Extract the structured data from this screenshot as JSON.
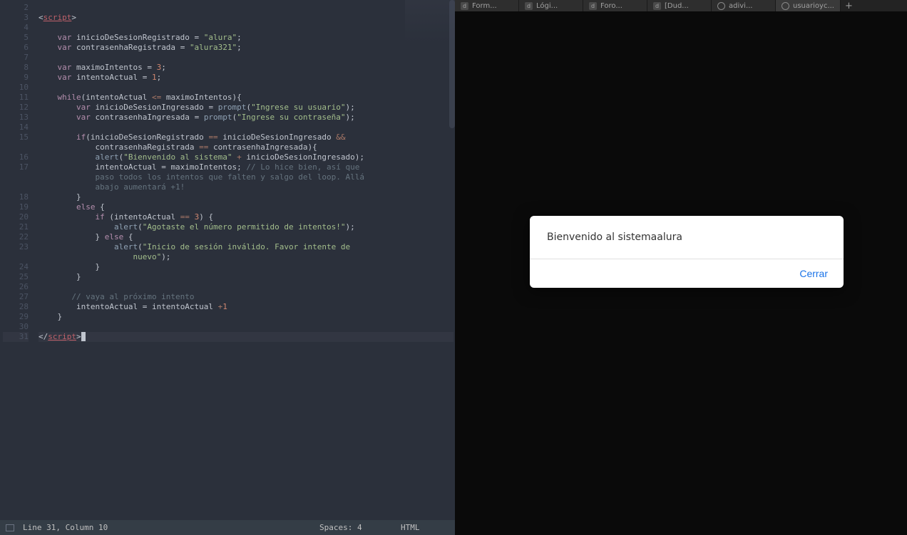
{
  "status_bar": {
    "position": "Line 31, Column 10",
    "spaces": "Spaces: 4",
    "language": "HTML"
  },
  "line_numbers": [
    "2",
    "3",
    "4",
    "5",
    "6",
    "7",
    "8",
    "9",
    "10",
    "11",
    "12",
    "13",
    "14",
    "15",
    "",
    "16",
    "17",
    "",
    "",
    "18",
    "19",
    "20",
    "21",
    "22",
    "23",
    "",
    "24",
    "25",
    "26",
    "27",
    "28",
    "29",
    "30",
    "31"
  ],
  "code_tokens": [
    [],
    [
      [
        "punct",
        "<"
      ],
      [
        "tag",
        "script"
      ],
      [
        "punct",
        ">"
      ]
    ],
    [],
    [
      [
        "kw",
        "    var"
      ],
      [
        "var",
        " inicioDeSesionRegistrado "
      ],
      [
        "op",
        "= "
      ],
      [
        "str",
        "\"alura\""
      ],
      [
        "punct",
        ";"
      ]
    ],
    [
      [
        "kw",
        "    var"
      ],
      [
        "var",
        " contrasenhaRegistrada "
      ],
      [
        "op",
        "= "
      ],
      [
        "str",
        "\"alura321\""
      ],
      [
        "punct",
        ";"
      ]
    ],
    [],
    [
      [
        "kw",
        "    var"
      ],
      [
        "var",
        " maximoIntentos "
      ],
      [
        "op",
        "= "
      ],
      [
        "num",
        "3"
      ],
      [
        "punct",
        ";"
      ]
    ],
    [
      [
        "kw",
        "    var"
      ],
      [
        "var",
        " intentoActual "
      ],
      [
        "op",
        "= "
      ],
      [
        "num",
        "1"
      ],
      [
        "punct",
        ";"
      ]
    ],
    [],
    [
      [
        "kw",
        "    while"
      ],
      [
        "punct",
        "("
      ],
      [
        "var",
        "intentoActual "
      ],
      [
        "op2",
        "<="
      ],
      [
        "var",
        " maximoIntentos"
      ],
      [
        "punct",
        "){"
      ]
    ],
    [
      [
        "kw",
        "        var"
      ],
      [
        "var",
        " inicioDeSesionIngresado "
      ],
      [
        "op",
        "= "
      ],
      [
        "fn",
        "prompt"
      ],
      [
        "punct",
        "("
      ],
      [
        "str",
        "\"Ingrese su usuario\""
      ],
      [
        "punct",
        ");"
      ]
    ],
    [
      [
        "kw",
        "        var"
      ],
      [
        "var",
        " contrasenhaIngresada "
      ],
      [
        "op",
        "= "
      ],
      [
        "fn",
        "prompt"
      ],
      [
        "punct",
        "("
      ],
      [
        "str",
        "\"Ingrese su contraseña\""
      ],
      [
        "punct",
        ");"
      ]
    ],
    [],
    [
      [
        "kw",
        "        if"
      ],
      [
        "punct",
        "("
      ],
      [
        "var",
        "inicioDeSesionRegistrado "
      ],
      [
        "op2",
        "=="
      ],
      [
        "var",
        " inicioDeSesionIngresado "
      ],
      [
        "op2",
        "&&"
      ]
    ],
    [
      [
        "var",
        "            contrasenhaRegistrada "
      ],
      [
        "op2",
        "=="
      ],
      [
        "var",
        " contrasenhaIngresada"
      ],
      [
        "punct",
        "){"
      ]
    ],
    [
      [
        "fn",
        "            alert"
      ],
      [
        "punct",
        "("
      ],
      [
        "str",
        "\"Bienvenido al sistema\""
      ],
      [
        "op2",
        " + "
      ],
      [
        "var",
        "inicioDeSesionIngresado"
      ],
      [
        "punct",
        ");"
      ]
    ],
    [
      [
        "var",
        "            intentoActual "
      ],
      [
        "op",
        "= "
      ],
      [
        "var",
        "maximoIntentos"
      ],
      [
        "punct",
        "; "
      ],
      [
        "cmt",
        "// Lo hice bien, así que"
      ]
    ],
    [
      [
        "cmt",
        "            paso todos los intentos que falten y salgo del loop. Allá"
      ]
    ],
    [
      [
        "cmt",
        "            abajo aumentará +1!"
      ]
    ],
    [
      [
        "punct",
        "        }"
      ]
    ],
    [
      [
        "kw",
        "        else"
      ],
      [
        "punct",
        " {"
      ]
    ],
    [
      [
        "kw",
        "            if"
      ],
      [
        "punct",
        " ("
      ],
      [
        "var",
        "intentoActual "
      ],
      [
        "op2",
        "=="
      ],
      [
        "var",
        " "
      ],
      [
        "num",
        "3"
      ],
      [
        "punct",
        ") {"
      ]
    ],
    [
      [
        "fn",
        "                alert"
      ],
      [
        "punct",
        "("
      ],
      [
        "str",
        "\"Agotaste el número permitido de intentos!\""
      ],
      [
        "punct",
        ");"
      ]
    ],
    [
      [
        "punct",
        "            } "
      ],
      [
        "kw",
        "else"
      ],
      [
        "punct",
        " {"
      ]
    ],
    [
      [
        "fn",
        "                alert"
      ],
      [
        "punct",
        "("
      ],
      [
        "str",
        "\"Inicio de sesión inválido. Favor intente de"
      ]
    ],
    [
      [
        "str",
        "                    nuevo\""
      ],
      [
        "punct",
        ");"
      ]
    ],
    [
      [
        "punct",
        "            }"
      ]
    ],
    [
      [
        "punct",
        "        }"
      ]
    ],
    [],
    [
      [
        "cmt",
        "       // vaya al próximo intento"
      ]
    ],
    [
      [
        "var",
        "        intentoActual "
      ],
      [
        "op",
        "= "
      ],
      [
        "var",
        "intentoActual "
      ],
      [
        "op2",
        "+"
      ],
      [
        "num",
        "1"
      ]
    ],
    [
      [
        "punct",
        "    }"
      ]
    ],
    [],
    [
      [
        "punct",
        "</"
      ],
      [
        "tag",
        "script"
      ],
      [
        "punct",
        ">"
      ],
      [
        "cursor-char",
        " "
      ]
    ]
  ],
  "current_line_idx": 33,
  "tabs": [
    {
      "title": "Form...",
      "icon_type": "d"
    },
    {
      "title": "Lógi...",
      "icon_type": "d"
    },
    {
      "title": "Foro...",
      "icon_type": "d"
    },
    {
      "title": "[Dud...",
      "icon_type": "d"
    },
    {
      "title": "adivi...",
      "icon_type": "safari"
    },
    {
      "title": "usuarioyc...",
      "icon_type": "safari",
      "active": true
    }
  ],
  "new_tab_label": "+",
  "dialog": {
    "message": "Bienvenido al sistemaalura",
    "button": "Cerrar"
  }
}
